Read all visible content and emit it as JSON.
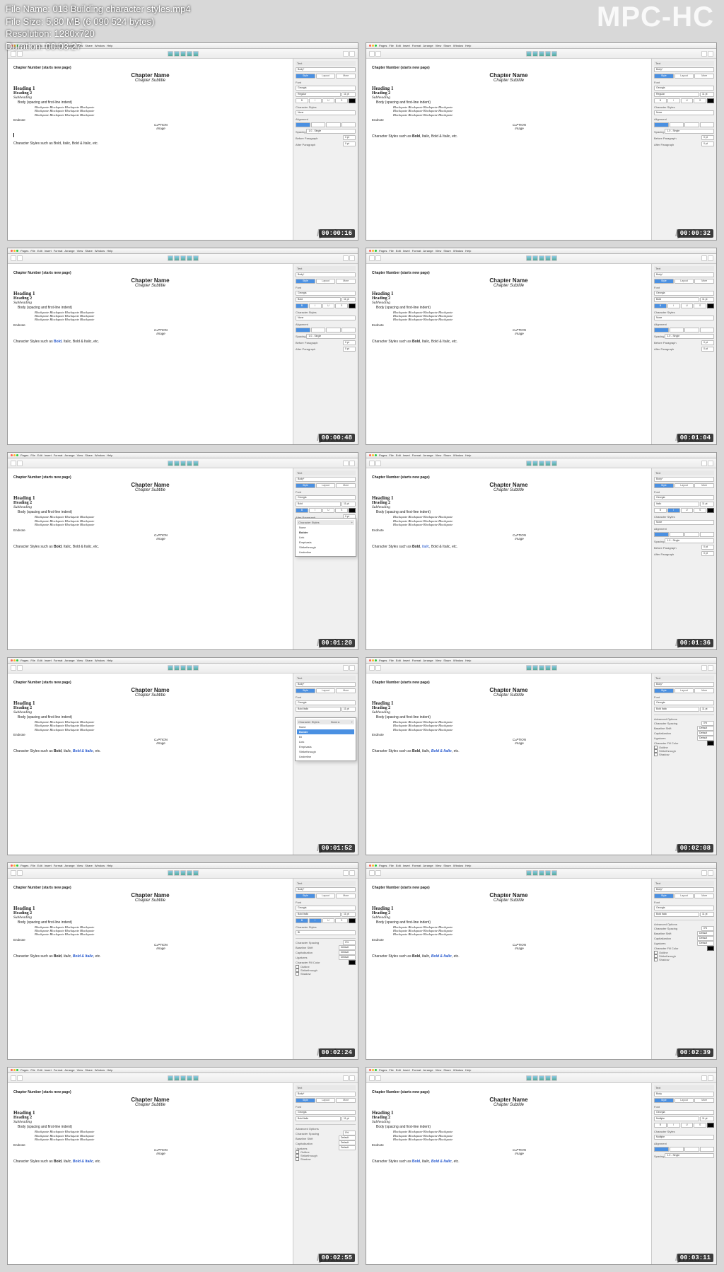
{
  "overlay": {
    "file_name": "File Name: 013 Building character styles.mp4",
    "file_size": "File Size: 5,80 MB (6 090 524 bytes)",
    "resolution": "Resolution: 1280x720",
    "duration": "Duration: 00:03:27",
    "logo": "MPC-HC"
  },
  "menubar": [
    "Pages",
    "File",
    "Edit",
    "Insert",
    "Format",
    "Arrange",
    "View",
    "Share",
    "Window",
    "Help"
  ],
  "doc": {
    "chapter_num": "Chapter Number (starts new page)",
    "chapter_name": "Chapter Name",
    "chapter_sub": "Chapter Subtitle",
    "h1": "Heading 1",
    "h2": "Heading 2",
    "subh": "Subheading",
    "body": "Body (spacing and first-line indent)",
    "blockq1": "Blockquote Blockquote Blockquote Blockquote",
    "blockq2": "Blockquote Blockquote Blockquote Blockquote",
    "blockq3": "Blockquote Blockquote Blockquote Blockquote",
    "endnote": "Endnote",
    "caption": "CaPTION",
    "image": "Image",
    "cs_prefix": "Character Styles such as ",
    "cs_bold": "Bold",
    "cs_sep": ", ",
    "cs_italic": "Italic",
    "cs_bi": "Bold & Italic",
    "cs_suffix": ", etc."
  },
  "panel": {
    "tab_text": "Text",
    "body_star": "Body*",
    "btn_style": "Style",
    "btn_layout": "Layout",
    "btn_more": "More",
    "lbl_font": "Font",
    "font_georgia": "Georgia",
    "font_regular": "Regular",
    "size_11": "11 pt",
    "lbl_char_styles": "Character Styles",
    "cs_none": "None",
    "lbl_alignment": "Alignment",
    "lbl_spacing": "Spacing",
    "spacing_val": "1.0 - Single",
    "lbl_before": "Before Paragraph",
    "lbl_after": "After Paragraph",
    "pt_0": "0 pt",
    "lbl_advanced": "Advanced Options",
    "lbl_char_spacing": "Character Spacing",
    "pct_0": "0%",
    "lbl_baseline": "Baseline Shift",
    "default": "Default",
    "lbl_capitalization": "Capitalization",
    "lbl_ligatures": "Ligatures",
    "lbl_char_fill": "Character Fill Color",
    "chk_outline": "Outline",
    "chk_strike": "Strikethrough",
    "chk_shadow": "Shadow"
  },
  "popup_styles": {
    "none": "None",
    "bolder": "Bolder",
    "link": "Link",
    "emphasis": "Emphasis",
    "strikethrough": "Strikethrough",
    "underline": "Underline",
    "bi": "BI",
    "btn_plus": "+"
  },
  "watermark": "lynda",
  "timestamps": [
    "00:00:16",
    "00:00:32",
    "00:00:48",
    "00:01:04",
    "00:01:20",
    "00:01:36",
    "00:01:52",
    "00:02:08",
    "00:02:24",
    "00:02:39",
    "00:02:55",
    "00:03:11"
  ]
}
